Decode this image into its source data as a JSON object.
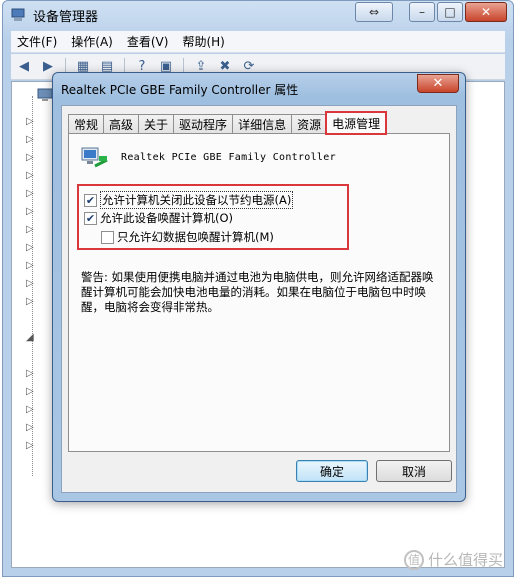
{
  "main_window": {
    "title": "设备管理器",
    "menu": [
      "文件(F)",
      "操作(A)",
      "查看(V)",
      "帮助(H)"
    ],
    "toolbar_icons": [
      "back-arrow-icon",
      "forward-arrow-icon",
      "tree-view-icon",
      "properties-icon",
      "help-icon",
      "device-view-icon",
      "update-driver-icon",
      "uninstall-icon",
      "scan-hardware-icon"
    ],
    "caption_special": "⇔",
    "caption_min": "–",
    "caption_max": "□",
    "caption_close": "✕"
  },
  "dialog": {
    "title": "Realtek PCIe GBE Family Controller 属性",
    "close": "✕",
    "tabs": [
      "常规",
      "高级",
      "关于",
      "驱动程序",
      "详细信息",
      "资源",
      "电源管理"
    ],
    "active_tab": "电源管理",
    "device_name": "Realtek PCIe GBE Family Controller",
    "options": [
      {
        "label": "允许计算机关闭此设备以节约电源(A)",
        "checked": true,
        "enabled": true
      },
      {
        "label": "允许此设备唤醒计算机(O)",
        "checked": true,
        "enabled": true
      },
      {
        "label": "只允许幻数据包唤醒计算机(M)",
        "checked": false,
        "enabled": true
      }
    ],
    "warning_text": "警告: 如果使用便携电脑并通过电池为电脑供电，则允许网络适配器唤醒计算机可能会加快电池电量的消耗。如果在电脑位于电脑包中时唤醒，电脑将会变得非常热。",
    "ok_label": "确定",
    "cancel_label": "取消"
  },
  "watermark": {
    "badge": "值",
    "text": "什么值得买"
  },
  "colors": {
    "highlight_red": "#d9373c",
    "title_blue": "#b7cfe9"
  }
}
